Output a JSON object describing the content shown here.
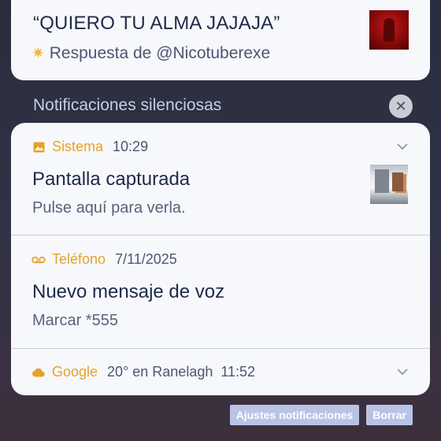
{
  "top_notification": {
    "title": "“QUIERO TU ALMA JAJAJA”",
    "reply_icon": "sparkle-icon",
    "reply_text": "Respuesta de @Nicotuberexe"
  },
  "section": {
    "label": "Notificaciones silenciosas",
    "dismiss_icon": "close-icon"
  },
  "notifications": [
    {
      "icon": "image-icon",
      "app": "Sistema",
      "meta": "10:29",
      "title": "Pantalla capturada",
      "text": "Pulse aquí para verla.",
      "expand_icon": "chevron-down-icon"
    },
    {
      "icon": "voicemail-icon",
      "app": "Teléfono",
      "meta": "7/11/2025",
      "title": "Nuevo mensaje de voz",
      "text": "Marcar *555"
    },
    {
      "icon": "cloud-icon",
      "app": "Google",
      "meta": "20° en Ranelagh  11:52",
      "expand_icon": "chevron-down-icon"
    }
  ],
  "actions": {
    "settings_label": "Ajustes notificaciones",
    "clear_label": "Borrar"
  },
  "colors": {
    "accent_app": "#e6a12a",
    "card_bg": "#f7f8fc",
    "title_text": "#1e2a4a",
    "action_button": "#b9c3e6"
  }
}
